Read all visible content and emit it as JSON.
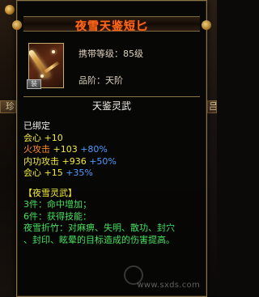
{
  "tooltip": {
    "title": "夜雪天鉴短匕",
    "level": "携带等级：85级",
    "grade": "品阶：天阶",
    "name": "天鉴灵武",
    "bind": "已绑定",
    "badge": "装",
    "stats": [
      {
        "label": "会心",
        "base": "+10",
        "bonus": ""
      },
      {
        "label": "火攻击",
        "base": "+103",
        "bonus": "+80%"
      },
      {
        "label": "内功攻击",
        "base": "+936",
        "bonus": "+50%"
      },
      {
        "label": "会心",
        "base": "+15",
        "bonus": "+35%"
      }
    ],
    "set_title": "【夜雪灵武】",
    "set_3": "3件：命中增加；",
    "set_6": "6件：获得技能：",
    "skill_line1": "夜雪折竹：对麻痹、失明、散功、封穴",
    "skill_line2": "、封印、眩晕的目标造成的伤害提高。",
    "watermark": "www.sxds.com"
  },
  "background": {
    "left_tab": "珍",
    "right_tab": "吕"
  }
}
